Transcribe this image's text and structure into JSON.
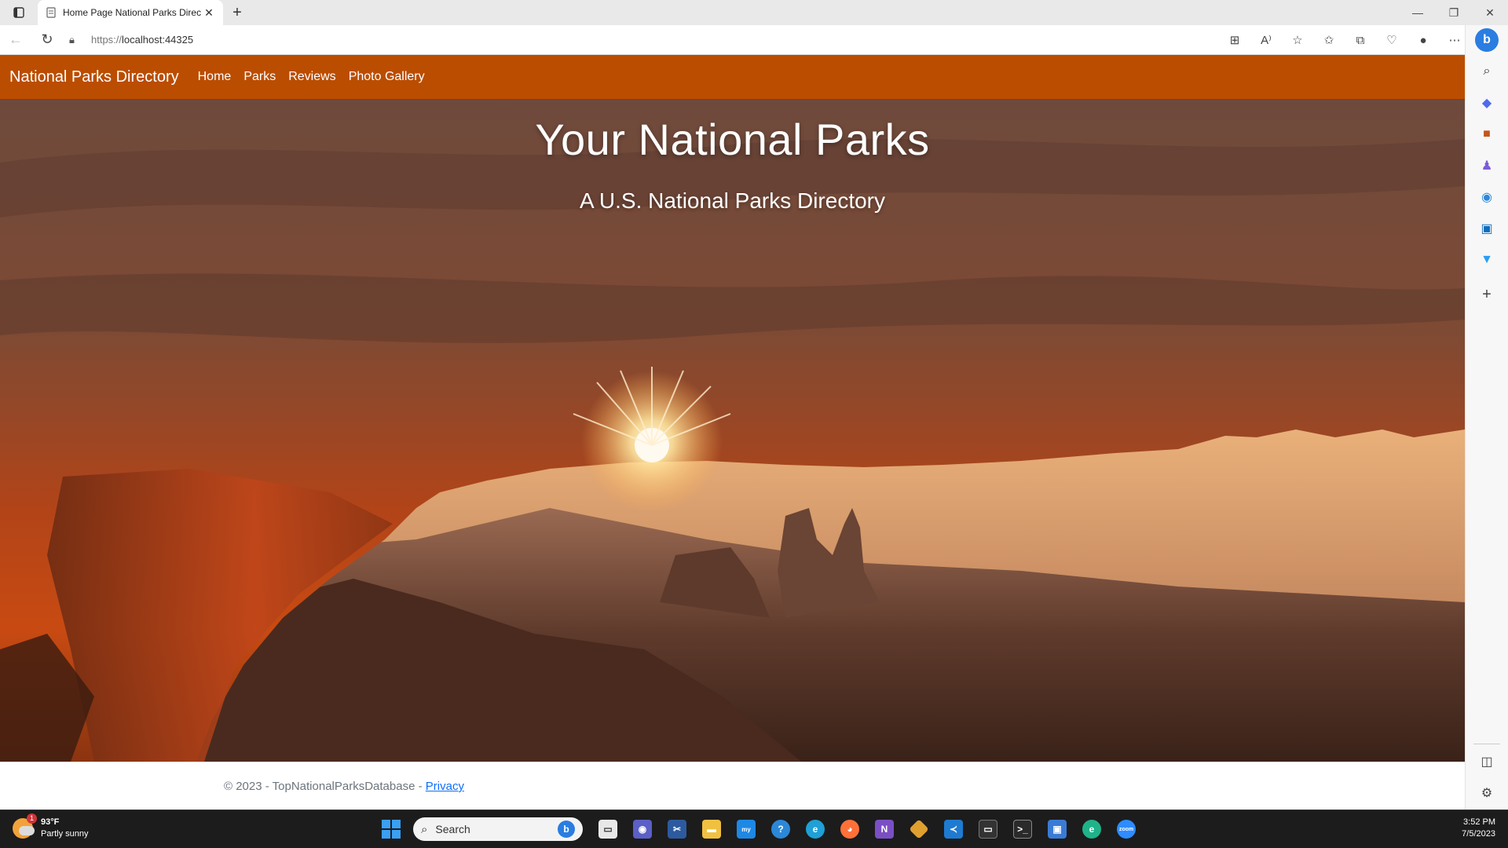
{
  "browser": {
    "tab_title": "Home Page National Parks Direc",
    "url_protocol": "https://",
    "url_host": "localhost:44325"
  },
  "site": {
    "brand": "National Parks Directory",
    "nav": [
      "Home",
      "Parks",
      "Reviews",
      "Photo Gallery"
    ]
  },
  "hero": {
    "title": "Your National Parks",
    "subtitle": "A U.S. National Parks Directory"
  },
  "footer": {
    "copyright": "© 2023 - TopNationalParksDatabase - ",
    "privacy_link": "Privacy"
  },
  "taskbar": {
    "weather_temp": "93°F",
    "weather_desc": "Partly sunny",
    "weather_badge": "1",
    "search_label": "Search",
    "time": "3:52 PM",
    "date": "7/5/2023"
  },
  "colors": {
    "navbar": "#bb4d00",
    "link": "#0d6efd"
  }
}
